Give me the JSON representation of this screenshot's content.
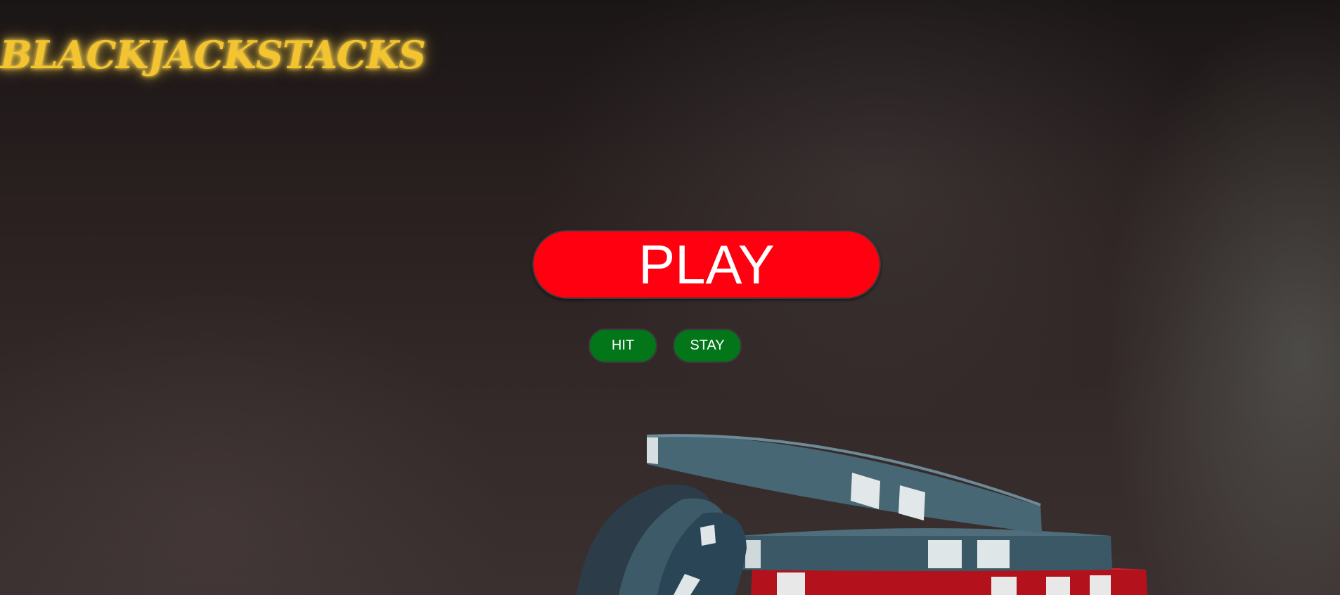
{
  "header": {
    "logo_text": "BLACKJACKSTACKS"
  },
  "controls": {
    "play_label": "PLAY",
    "hit_label": "HIT",
    "stay_label": "STAY"
  },
  "colors": {
    "logo": "#f4c430",
    "play_button": "#ff0010",
    "action_button": "#03761a",
    "background": "#2a2020"
  },
  "background_image": {
    "subject": "poker-chip-stack"
  }
}
